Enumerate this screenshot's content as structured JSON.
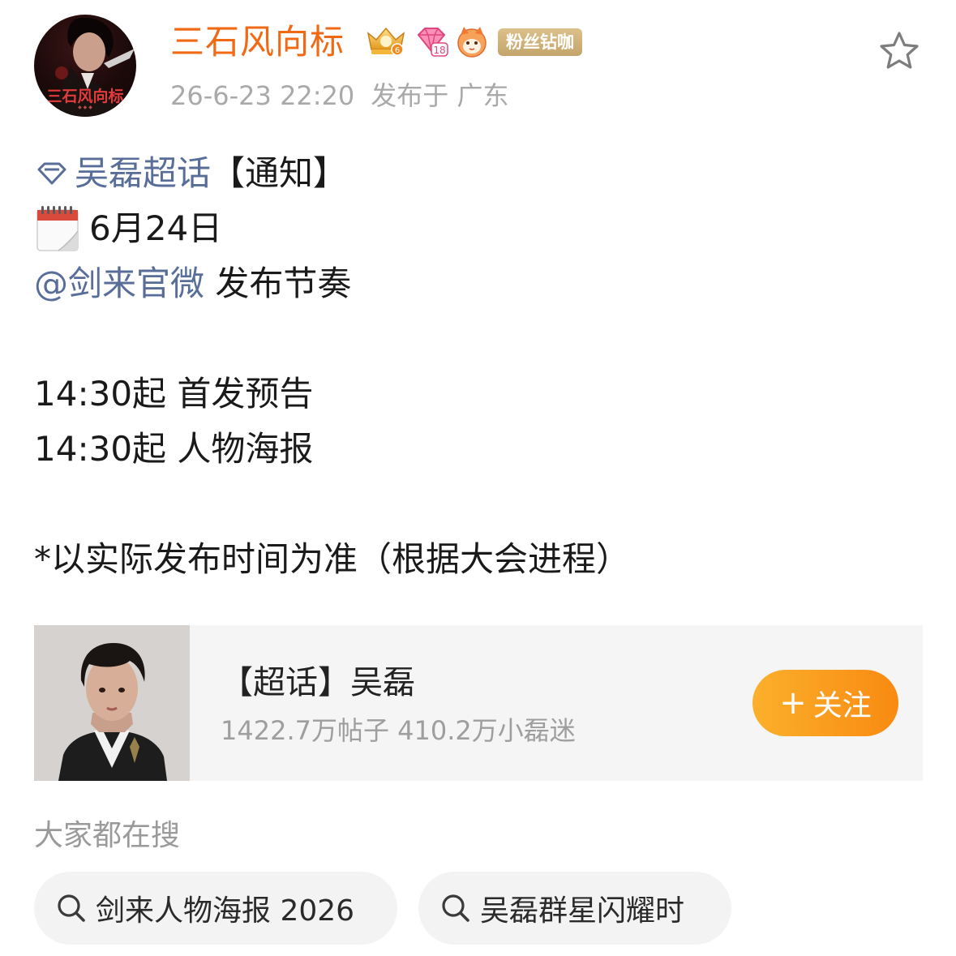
{
  "post": {
    "author": {
      "name": "三石风向标",
      "avatar_text": "三石风向标",
      "fan_badge": "粉丝钻咖",
      "badges": [
        "crown-level-6-icon",
        "diamond-level-18-icon",
        "cat-mascot-icon"
      ]
    },
    "timestamp": "26-6-23 22:20",
    "location": "发布于 广东",
    "content": {
      "topic": "吴磊超话",
      "topic_suffix": "【通知】",
      "date": "6月24日",
      "mention": "@剑来官微",
      "mention_suffix": " 发布节奏",
      "schedule": [
        "14:30起 首发预告",
        "14:30起 人物海报"
      ],
      "note": "*以实际发布时间为准（根据大会进程）"
    }
  },
  "supertopic_card": {
    "title": "【超话】吴磊",
    "stats": "1422.7万帖子 410.2万小磊迷",
    "follow_label": "关注",
    "follow_plus": "+"
  },
  "search": {
    "heading": "大家都在搜",
    "suggestions": [
      "剑来人物海报 2026",
      "吴磊群星闪耀时"
    ]
  },
  "colors": {
    "username": "#f06a16",
    "link": "#586e99",
    "follow_button": "#f98a12",
    "fan_badge": "#c4a46a"
  }
}
